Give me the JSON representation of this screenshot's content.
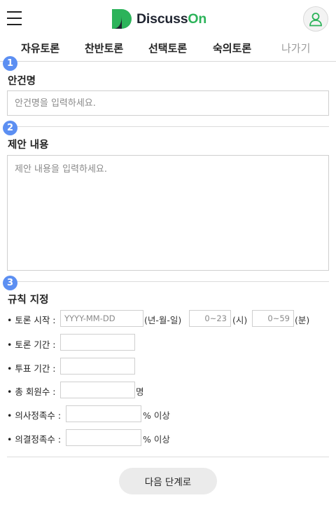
{
  "header": {
    "logo_text_a": "Discuss",
    "logo_text_b": "On",
    "brand_color": "#2cb35a",
    "menu_icon": "hamburger-menu-icon",
    "avatar_icon": "user-icon"
  },
  "nav": {
    "items": [
      "자유토론",
      "찬반토론",
      "선택토론",
      "숙의토론"
    ],
    "exit_label": "나가기"
  },
  "steps": [
    "1",
    "2",
    "3"
  ],
  "accent_color": "#5c8ff2",
  "title_section": {
    "label": "안건명",
    "placeholder": "안건명을 입력하세요."
  },
  "proposal_section": {
    "label": "제안 내용",
    "placeholder": "제안 내용을 입력하세요."
  },
  "rules_section": {
    "label": "규칙 지정",
    "start": {
      "label": "• 토론 시작 :",
      "date_placeholder": "YYYY-MM-DD",
      "date_hint": "(년-월-일)",
      "hour_placeholder": "0~23",
      "hour_unit": "(시)",
      "minute_placeholder": "0~59",
      "minute_unit": "(분)"
    },
    "duration_label": "• 토론 기간 :",
    "vote_label": "• 투표 기간 :",
    "members_label": "• 총 회원수 :",
    "members_unit": "명",
    "quorum_label": "• 의사정족수 :",
    "quorum_unit": "% 이상",
    "decision_label": "• 의결정족수 :",
    "decision_unit": "% 이상"
  },
  "next_button": "다음 단계로"
}
